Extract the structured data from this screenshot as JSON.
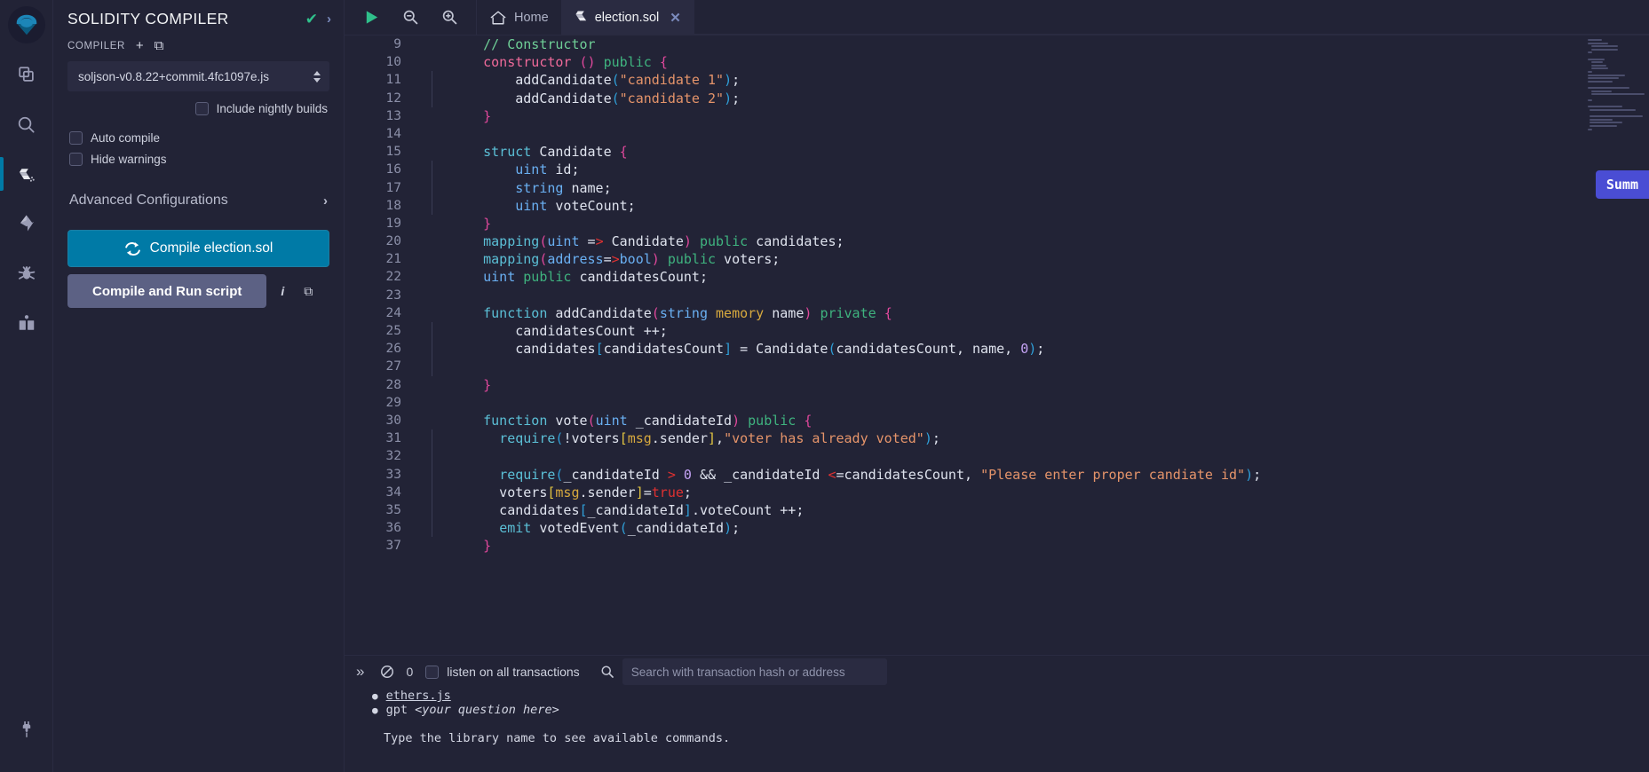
{
  "iconbar": {
    "logo_name": "remix-logo",
    "items": [
      {
        "name": "file-explorer-icon",
        "title": "File explorer"
      },
      {
        "name": "search-icon",
        "title": "Search in files"
      },
      {
        "name": "solidity-compiler-icon",
        "title": "Solidity compiler",
        "active": true
      },
      {
        "name": "deploy-run-icon",
        "title": "Deploy & run transactions"
      },
      {
        "name": "debugger-icon",
        "title": "Debugger"
      },
      {
        "name": "learneth-icon",
        "title": "Learneth"
      }
    ],
    "bottom_item": {
      "name": "plugin-manager-icon",
      "title": "Plugin manager"
    }
  },
  "panel": {
    "title": "SOLIDITY COMPILER",
    "status_check": "✔",
    "expand_chevron": "›",
    "section_label": "COMPILER",
    "add_icon": "+",
    "copy_config_icon": "⧉",
    "compiler_version": "soljson-v0.8.22+commit.4fc1097e.js",
    "nightly_label": "Include nightly builds",
    "auto_compile_label": "Auto compile",
    "hide_warnings_label": "Hide warnings",
    "advanced_label": "Advanced Configurations",
    "advanced_chevron": "›",
    "compile_button": "Compile election.sol",
    "compile_run_button": "Compile and Run script",
    "info_icon": "i",
    "copy_icon": "⧉"
  },
  "topbar": {
    "run_icon": "▶",
    "zoom_out_icon": "zoom-out",
    "zoom_in_icon": "zoom-in",
    "home_label": "Home",
    "tabs": [
      {
        "label": "election.sol",
        "active": true,
        "close": "✕"
      }
    ]
  },
  "editor": {
    "summary_pill": "Summ",
    "lines": [
      {
        "n": 9,
        "indent": false,
        "tokens": [
          {
            "t": "    ",
            "c": "t-var"
          },
          {
            "t": "// Constructor",
            "c": "t-com"
          }
        ]
      },
      {
        "n": 10,
        "indent": false,
        "tokens": [
          {
            "t": "    ",
            "c": "t-var"
          },
          {
            "t": "constructor",
            "c": "t-key"
          },
          {
            "t": " ",
            "c": "t-var"
          },
          {
            "t": "()",
            "c": "t-brc"
          },
          {
            "t": " ",
            "c": "t-var"
          },
          {
            "t": "public",
            "c": "t-key2"
          },
          {
            "t": " ",
            "c": "t-var"
          },
          {
            "t": "{",
            "c": "t-brc"
          }
        ]
      },
      {
        "n": 11,
        "indent": true,
        "tokens": [
          {
            "t": "        addCandidate",
            "c": "t-var"
          },
          {
            "t": "(",
            "c": "t-brk"
          },
          {
            "t": "\"candidate 1\"",
            "c": "t-str"
          },
          {
            "t": ")",
            "c": "t-brk"
          },
          {
            "t": ";",
            "c": "t-var"
          }
        ]
      },
      {
        "n": 12,
        "indent": true,
        "tokens": [
          {
            "t": "        addCandidate",
            "c": "t-var"
          },
          {
            "t": "(",
            "c": "t-brk"
          },
          {
            "t": "\"candidate 2\"",
            "c": "t-str"
          },
          {
            "t": ")",
            "c": "t-brk"
          },
          {
            "t": ";",
            "c": "t-var"
          }
        ]
      },
      {
        "n": 13,
        "indent": false,
        "tokens": [
          {
            "t": "    ",
            "c": "t-var"
          },
          {
            "t": "}",
            "c": "t-brc"
          }
        ]
      },
      {
        "n": 14,
        "indent": false,
        "tokens": []
      },
      {
        "n": 15,
        "indent": false,
        "tokens": [
          {
            "t": "    ",
            "c": "t-var"
          },
          {
            "t": "struct",
            "c": "t-fn"
          },
          {
            "t": " Candidate ",
            "c": "t-var"
          },
          {
            "t": "{",
            "c": "t-brc"
          }
        ]
      },
      {
        "n": 16,
        "indent": true,
        "tokens": [
          {
            "t": "        ",
            "c": "t-var"
          },
          {
            "t": "uint",
            "c": "t-type"
          },
          {
            "t": " id;",
            "c": "t-var"
          }
        ]
      },
      {
        "n": 17,
        "indent": true,
        "tokens": [
          {
            "t": "        ",
            "c": "t-var"
          },
          {
            "t": "string",
            "c": "t-type"
          },
          {
            "t": " name;",
            "c": "t-var"
          }
        ]
      },
      {
        "n": 18,
        "indent": true,
        "tokens": [
          {
            "t": "        ",
            "c": "t-var"
          },
          {
            "t": "uint",
            "c": "t-type"
          },
          {
            "t": " voteCount;",
            "c": "t-var"
          }
        ]
      },
      {
        "n": 19,
        "indent": false,
        "tokens": [
          {
            "t": "    ",
            "c": "t-var"
          },
          {
            "t": "}",
            "c": "t-brc"
          }
        ]
      },
      {
        "n": 20,
        "indent": false,
        "tokens": [
          {
            "t": "    ",
            "c": "t-var"
          },
          {
            "t": "mapping",
            "c": "t-fn"
          },
          {
            "t": "(",
            "c": "t-brc"
          },
          {
            "t": "uint",
            "c": "t-type"
          },
          {
            "t": " =",
            "c": "t-var"
          },
          {
            "t": ">",
            "c": "t-arr"
          },
          {
            "t": " Candidate",
            "c": "t-var"
          },
          {
            "t": ")",
            "c": "t-brc"
          },
          {
            "t": " ",
            "c": "t-var"
          },
          {
            "t": "public",
            "c": "t-key2"
          },
          {
            "t": " candidates;",
            "c": "t-var"
          }
        ]
      },
      {
        "n": 21,
        "indent": false,
        "tokens": [
          {
            "t": "    ",
            "c": "t-var"
          },
          {
            "t": "mapping",
            "c": "t-fn"
          },
          {
            "t": "(",
            "c": "t-brc"
          },
          {
            "t": "address",
            "c": "t-type"
          },
          {
            "t": "=",
            "c": "t-var"
          },
          {
            "t": ">",
            "c": "t-arr"
          },
          {
            "t": "bool",
            "c": "t-type"
          },
          {
            "t": ")",
            "c": "t-brc"
          },
          {
            "t": " ",
            "c": "t-var"
          },
          {
            "t": "public",
            "c": "t-key2"
          },
          {
            "t": " voters;",
            "c": "t-var"
          }
        ]
      },
      {
        "n": 22,
        "indent": false,
        "tokens": [
          {
            "t": "    ",
            "c": "t-var"
          },
          {
            "t": "uint",
            "c": "t-type"
          },
          {
            "t": " ",
            "c": "t-var"
          },
          {
            "t": "public",
            "c": "t-key2"
          },
          {
            "t": " candidatesCount;",
            "c": "t-var"
          }
        ]
      },
      {
        "n": 23,
        "indent": false,
        "tokens": []
      },
      {
        "n": 24,
        "indent": false,
        "tokens": [
          {
            "t": "    ",
            "c": "t-var"
          },
          {
            "t": "function",
            "c": "t-fn"
          },
          {
            "t": " addCandidate",
            "c": "t-var"
          },
          {
            "t": "(",
            "c": "t-brc"
          },
          {
            "t": "string",
            "c": "t-type"
          },
          {
            "t": " ",
            "c": "t-var"
          },
          {
            "t": "memory",
            "c": "t-mem"
          },
          {
            "t": " name",
            "c": "t-var"
          },
          {
            "t": ")",
            "c": "t-brc"
          },
          {
            "t": " ",
            "c": "t-var"
          },
          {
            "t": "private",
            "c": "t-key2"
          },
          {
            "t": " ",
            "c": "t-var"
          },
          {
            "t": "{",
            "c": "t-brc"
          }
        ]
      },
      {
        "n": 25,
        "indent": true,
        "tokens": [
          {
            "t": "        candidatesCount ++;",
            "c": "t-var"
          }
        ]
      },
      {
        "n": 26,
        "indent": true,
        "tokens": [
          {
            "t": "        candidates",
            "c": "t-var"
          },
          {
            "t": "[",
            "c": "t-brk"
          },
          {
            "t": "candidatesCount",
            "c": "t-var"
          },
          {
            "t": "]",
            "c": "t-brk"
          },
          {
            "t": " = Candidate",
            "c": "t-var"
          },
          {
            "t": "(",
            "c": "t-brk"
          },
          {
            "t": "candidatesCount, name, ",
            "c": "t-var"
          },
          {
            "t": "0",
            "c": "t-num"
          },
          {
            "t": ")",
            "c": "t-brk"
          },
          {
            "t": ";",
            "c": "t-var"
          }
        ]
      },
      {
        "n": 27,
        "indent": true,
        "tokens": []
      },
      {
        "n": 28,
        "indent": false,
        "tokens": [
          {
            "t": "    ",
            "c": "t-var"
          },
          {
            "t": "}",
            "c": "t-brc"
          }
        ]
      },
      {
        "n": 29,
        "indent": false,
        "tokens": []
      },
      {
        "n": 30,
        "indent": false,
        "tokens": [
          {
            "t": "    ",
            "c": "t-var"
          },
          {
            "t": "function",
            "c": "t-fn"
          },
          {
            "t": " vote",
            "c": "t-var"
          },
          {
            "t": "(",
            "c": "t-brc"
          },
          {
            "t": "uint",
            "c": "t-type"
          },
          {
            "t": " _candidateId",
            "c": "t-var"
          },
          {
            "t": ")",
            "c": "t-brc"
          },
          {
            "t": " ",
            "c": "t-var"
          },
          {
            "t": "public",
            "c": "t-key2"
          },
          {
            "t": " ",
            "c": "t-var"
          },
          {
            "t": "{",
            "c": "t-brc"
          }
        ]
      },
      {
        "n": 31,
        "indent": true,
        "tokens": [
          {
            "t": "      ",
            "c": "t-var"
          },
          {
            "t": "require",
            "c": "t-fn"
          },
          {
            "t": "(",
            "c": "t-brk"
          },
          {
            "t": "!voters",
            "c": "t-var"
          },
          {
            "t": "[",
            "c": "t-brk2"
          },
          {
            "t": "msg",
            "c": "t-mem"
          },
          {
            "t": ".sender",
            "c": "t-var"
          },
          {
            "t": "]",
            "c": "t-brk2"
          },
          {
            "t": ",",
            "c": "t-var"
          },
          {
            "t": "\"voter has already voted\"",
            "c": "t-str"
          },
          {
            "t": ")",
            "c": "t-brk"
          },
          {
            "t": ";",
            "c": "t-var"
          }
        ]
      },
      {
        "n": 32,
        "indent": true,
        "tokens": []
      },
      {
        "n": 33,
        "indent": true,
        "tokens": [
          {
            "t": "      ",
            "c": "t-var"
          },
          {
            "t": "require",
            "c": "t-fn"
          },
          {
            "t": "(",
            "c": "t-brk"
          },
          {
            "t": "_candidateId ",
            "c": "t-var"
          },
          {
            "t": ">",
            "c": "t-arr"
          },
          {
            "t": " ",
            "c": "t-var"
          },
          {
            "t": "0",
            "c": "t-num"
          },
          {
            "t": " && ",
            "c": "t-var"
          },
          {
            "t": "_candidateId ",
            "c": "t-var"
          },
          {
            "t": "<",
            "c": "t-arr"
          },
          {
            "t": "=candidatesCount, ",
            "c": "t-var"
          },
          {
            "t": "\"Please enter proper candiate id\"",
            "c": "t-str"
          },
          {
            "t": ")",
            "c": "t-brk"
          },
          {
            "t": ";",
            "c": "t-var"
          }
        ]
      },
      {
        "n": 34,
        "indent": true,
        "tokens": [
          {
            "t": "      voters",
            "c": "t-var"
          },
          {
            "t": "[",
            "c": "t-brk2"
          },
          {
            "t": "msg",
            "c": "t-mem"
          },
          {
            "t": ".sender",
            "c": "t-var"
          },
          {
            "t": "]",
            "c": "t-brk2"
          },
          {
            "t": "=",
            "c": "t-var"
          },
          {
            "t": "true",
            "c": "t-bool"
          },
          {
            "t": ";",
            "c": "t-var"
          }
        ]
      },
      {
        "n": 35,
        "indent": true,
        "tokens": [
          {
            "t": "      candidates",
            "c": "t-var"
          },
          {
            "t": "[",
            "c": "t-brk"
          },
          {
            "t": "_candidateId",
            "c": "t-var"
          },
          {
            "t": "]",
            "c": "t-brk"
          },
          {
            "t": ".voteCount ++;",
            "c": "t-var"
          }
        ]
      },
      {
        "n": 36,
        "indent": true,
        "tokens": [
          {
            "t": "      ",
            "c": "t-var"
          },
          {
            "t": "emit",
            "c": "t-fn"
          },
          {
            "t": " votedEvent",
            "c": "t-var"
          },
          {
            "t": "(",
            "c": "t-brk"
          },
          {
            "t": "_candidateId",
            "c": "t-var"
          },
          {
            "t": ")",
            "c": "t-brk"
          },
          {
            "t": ";",
            "c": "t-var"
          }
        ]
      },
      {
        "n": 37,
        "indent": false,
        "tokens": [
          {
            "t": "    ",
            "c": "t-var"
          },
          {
            "t": "}",
            "c": "t-brc"
          }
        ]
      }
    ]
  },
  "terminal": {
    "collapse_icon": "»",
    "clear_icon": "⊘",
    "count": "0",
    "listen_label": "listen on all transactions",
    "search_icon": "search-icon",
    "search_placeholder": "Search with transaction hash or address",
    "log_items": [
      {
        "text": "ethers.js",
        "link": true
      },
      {
        "text": "gpt <your question here>",
        "link": false,
        "prefix": "gpt ",
        "italic": "<your question here>"
      }
    ],
    "note": "Type the library name to see available commands."
  },
  "colors": {
    "accent": "#007aa6",
    "bg": "#222336",
    "panel_alt": "#2a2b41",
    "summary_pill": "#4a4dd4",
    "success": "#2fc08b"
  }
}
